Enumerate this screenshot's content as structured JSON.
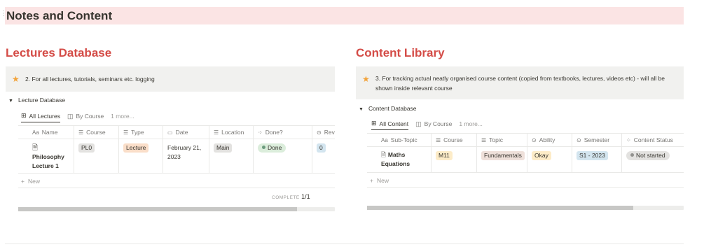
{
  "page": {
    "title": "Notes and Content"
  },
  "left": {
    "title": "Lectures Database",
    "callout": "2. For all lectures, tutorials, seminars etc. logging",
    "toggle_label": "Lecture Database",
    "tabs": [
      {
        "icon": "table-icon",
        "glyph": "⊞",
        "label": "All Lectures"
      },
      {
        "icon": "board-icon",
        "glyph": "◫",
        "label": "By Course"
      }
    ],
    "more": "1 more...",
    "columns": [
      {
        "icon": "Aa",
        "label": "Name"
      },
      {
        "icon": "☰",
        "label": "Course"
      },
      {
        "icon": "☰",
        "label": "Type"
      },
      {
        "icon": "▭",
        "label": "Date"
      },
      {
        "icon": "☰",
        "label": "Location"
      },
      {
        "icon": "⁘",
        "label": "Done?"
      },
      {
        "icon": "⊙",
        "label": "Rev"
      }
    ],
    "row": {
      "name": "Philosophy Lecture 1",
      "course": "PL0",
      "type": "Lecture",
      "date": "February 21, 2023",
      "location": "Main",
      "done": "Done",
      "rev": "0"
    },
    "new_label": "New",
    "complete_label": "COMPLETE",
    "complete_value": "1/1",
    "scroll_progress": 0.88
  },
  "right": {
    "title": "Content Library",
    "callout": "3. For tracking actual neatly organised course content (copied from textbooks, lectures, videos etc) - will all be shown inside relevant course",
    "toggle_label": "Content Database",
    "tabs": [
      {
        "icon": "table-icon",
        "glyph": "⊞",
        "label": "All Content"
      },
      {
        "icon": "board-icon",
        "glyph": "◫",
        "label": "By Course"
      }
    ],
    "more": "1 more...",
    "columns": [
      {
        "icon": "Aa",
        "label": "Sub-Topic"
      },
      {
        "icon": "☰",
        "label": "Course"
      },
      {
        "icon": "☰",
        "label": "Topic"
      },
      {
        "icon": "⊙",
        "label": "Ability"
      },
      {
        "icon": "⊙",
        "label": "Semester"
      },
      {
        "icon": "⁘",
        "label": "Content Status"
      }
    ],
    "row": {
      "name": "Maths Equations",
      "course": "M11",
      "topic": "Fundamentals",
      "ability": "Okay",
      "semester": "S1 - 2023",
      "status": "Not started"
    },
    "new_label": "New",
    "scroll_progress": 0.84
  },
  "colors": {
    "heading_bg": "#fbe4e4",
    "section_title": "#d44c47",
    "star": "#f2a33a",
    "tag_gray": "#e3e2e0",
    "tag_orange": "#fadec9",
    "tag_green": "#dbeddb",
    "tag_blue": "#d3e5ef",
    "tag_yellow": "#fdecc8",
    "tag_brown": "#eee0da"
  }
}
